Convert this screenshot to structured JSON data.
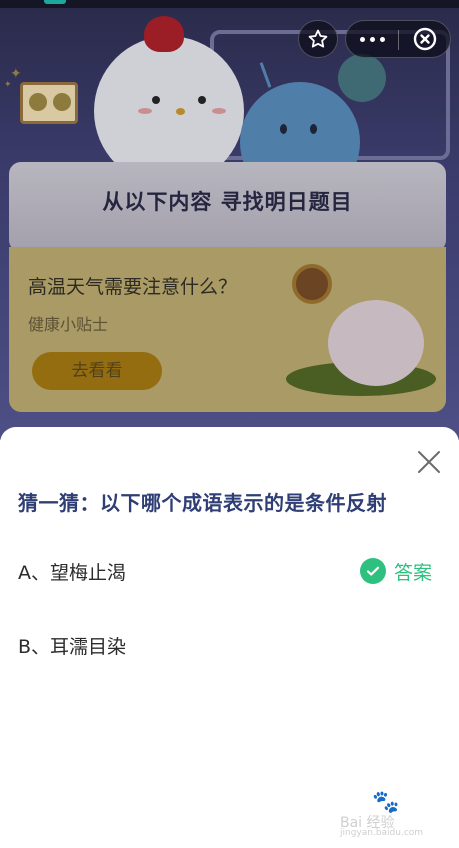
{
  "background": {
    "banner_title": "从以下内容 寻找明日题目",
    "tip": {
      "title": "高温天气需要注意什么？",
      "subtitle": "健康小贴士",
      "button_label": "去看看"
    }
  },
  "capsule": {
    "favorite_icon": "star-outline-icon",
    "more_icon": "more-dots-icon",
    "exit_icon": "circle-close-icon"
  },
  "quiz": {
    "question": "猜一猜：以下哪个成语表示的是条件反射",
    "options": [
      {
        "label": "A、望梅止渴",
        "is_answer": true
      },
      {
        "label": "B、耳濡目染",
        "is_answer": false
      }
    ],
    "answer_label": "答案",
    "answer_color": "#2ec07f",
    "question_color": "#2f3e74"
  },
  "watermark": {
    "text": "Bai 经验",
    "url": "jingyan.baidu.com"
  }
}
